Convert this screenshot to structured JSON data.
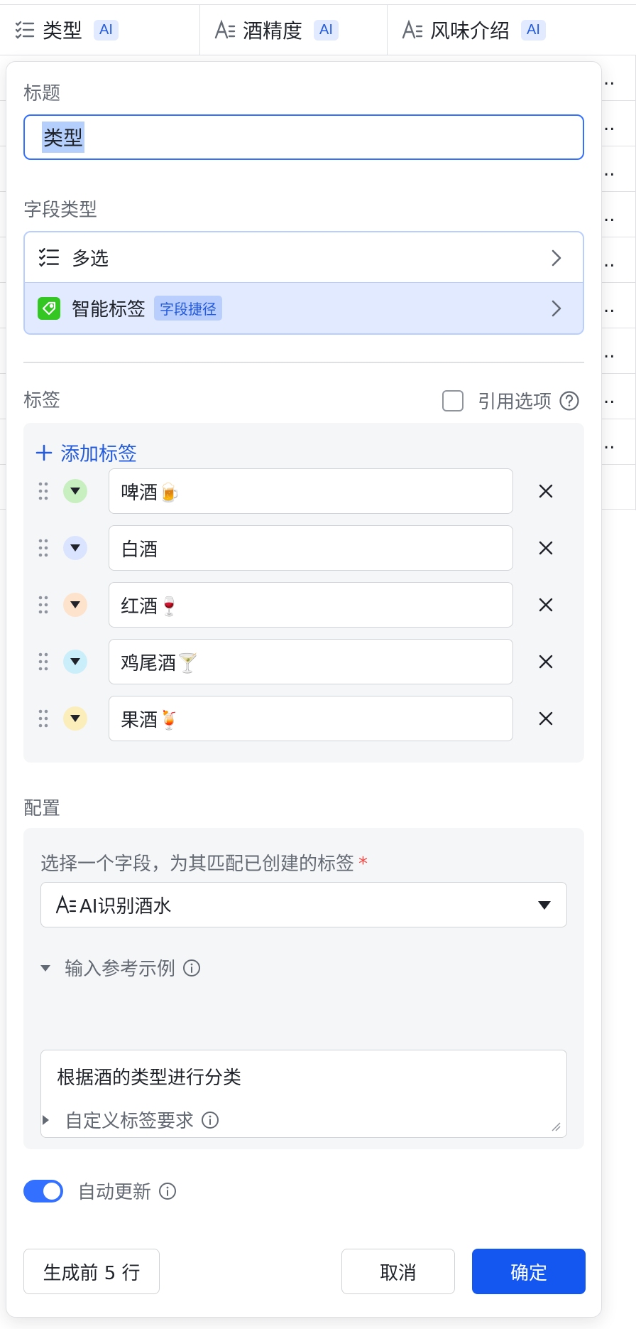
{
  "table": {
    "columns": [
      {
        "title": "类型",
        "badge": "AI",
        "icon": "multi-select-icon"
      },
      {
        "title": "酒精度",
        "badge": "AI",
        "icon": "text-field-icon"
      },
      {
        "title": "风味介绍",
        "badge": "AI",
        "icon": "text-field-icon"
      }
    ],
    "row_overflow": ".."
  },
  "panel": {
    "title_label": "标题",
    "title_value": "类型",
    "field_type_label": "字段类型",
    "field_type_primary": "多选",
    "field_type_smart": "智能标签",
    "field_type_smart_badge": "字段捷径",
    "tags_label": "标签",
    "reference_option": "引用选项",
    "add_tag": "添加标签",
    "tags": [
      {
        "text": "啤酒🍺",
        "color": "#c8efc0"
      },
      {
        "text": "白酒",
        "color": "#dbe4ff"
      },
      {
        "text": "红酒🍷",
        "color": "#fde2cc"
      },
      {
        "text": "鸡尾酒🍸",
        "color": "#caeffb"
      },
      {
        "text": "果酒🍹",
        "color": "#fbeebb"
      }
    ],
    "config_label": "配置",
    "config": {
      "select_prompt": "选择一个字段，为其匹配已创建的标签",
      "required_mark": "*",
      "selected_field": "AI识别酒水",
      "example_toggle": "输入参考示例",
      "example_value": "根据酒的类型进行分类",
      "custom_toggle": "自定义标签要求"
    },
    "auto_update_label": "自动更新",
    "auto_update_on": true,
    "buttons": {
      "generate": "生成前 5 行",
      "cancel": "取消",
      "confirm": "确定"
    }
  },
  "colors": {
    "accent": "#1456f0",
    "focus": "#3370ff",
    "smart_tag_green": "#34c724"
  }
}
